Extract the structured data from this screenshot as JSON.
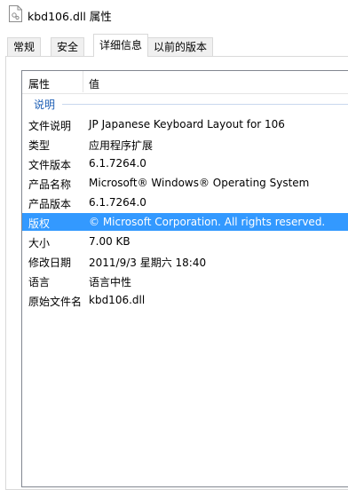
{
  "window": {
    "title": "kbd106.dll 属性",
    "icon": "dll-file-icon"
  },
  "tabs": [
    {
      "label": "常规"
    },
    {
      "label": "安全"
    },
    {
      "label": "详细信息"
    },
    {
      "label": "以前的版本"
    }
  ],
  "active_tab": "详细信息",
  "list": {
    "columns": {
      "property": "属性",
      "value": "值"
    },
    "group": "说明",
    "rows": [
      {
        "name": "文件说明",
        "value": "JP Japanese Keyboard Layout for 106"
      },
      {
        "name": "类型",
        "value": "应用程序扩展"
      },
      {
        "name": "文件版本",
        "value": "6.1.7264.0"
      },
      {
        "name": "产品名称",
        "value": "Microsoft® Windows® Operating System"
      },
      {
        "name": "产品版本",
        "value": "6.1.7264.0"
      },
      {
        "name": "版权",
        "value": "© Microsoft Corporation. All rights reserved."
      },
      {
        "name": "大小",
        "value": "7.00 KB"
      },
      {
        "name": "修改日期",
        "value": "2011/9/3 星期六 18:40"
      },
      {
        "name": "语言",
        "value": "语言中性"
      },
      {
        "name": "原始文件名",
        "value": "kbd106.dll"
      }
    ],
    "selected_row": "版权"
  },
  "colors": {
    "selection": "#3399ff",
    "group_text": "#1e5fb5"
  }
}
